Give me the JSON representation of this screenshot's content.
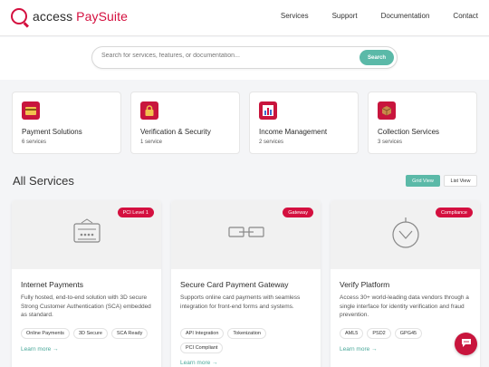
{
  "brand": {
    "prefix": "access ",
    "name": "PaySuite",
    "accent": "#d4103f"
  },
  "nav": [
    "Services",
    "Support",
    "Documentation",
    "Contact"
  ],
  "search": {
    "placeholder": "Search for services, features, or documentation...",
    "button": "Search",
    "button_color": "#5bb9a8"
  },
  "categories": [
    {
      "title": "Payment Solutions",
      "count": "6 services",
      "icon": "credit-card-icon"
    },
    {
      "title": "Verification & Security",
      "count": "1 service",
      "icon": "lock-icon"
    },
    {
      "title": "Income Management",
      "count": "2 services",
      "icon": "bar-chart-icon"
    },
    {
      "title": "Collection Services",
      "count": "3 services",
      "icon": "package-icon"
    }
  ],
  "section_title": "All Services",
  "view_toggle": {
    "grid": "Grid View",
    "list": "List View"
  },
  "services": [
    {
      "badge": "PCI Level 1",
      "title": "Internet Payments",
      "description": "Fully hosted, end-to-end solution with 3D secure Strong Customer Authentication (SCA) embedded as standard.",
      "tags": [
        "Online Payments",
        "3D Secure",
        "SCA Ready"
      ],
      "link": "Learn more →",
      "icon": "payment-terminal-icon"
    },
    {
      "badge": "Gateway",
      "title": "Secure Card Payment Gateway",
      "description": "Supports online card payments with seamless integration for front-end forms and systems.",
      "tags": [
        "API Integration",
        "Tokenization",
        "PCI Compliant"
      ],
      "link": "Learn more →",
      "icon": "link-icon"
    },
    {
      "badge": "Compliance",
      "title": "Verify Platform",
      "description": "Access 30+ world-leading data vendors through a single interface for identity verification and fraud prevention.",
      "tags": [
        "AML5",
        "PSD2",
        "GPG45"
      ],
      "link": "Learn more →",
      "icon": "verify-gauge-icon"
    }
  ]
}
